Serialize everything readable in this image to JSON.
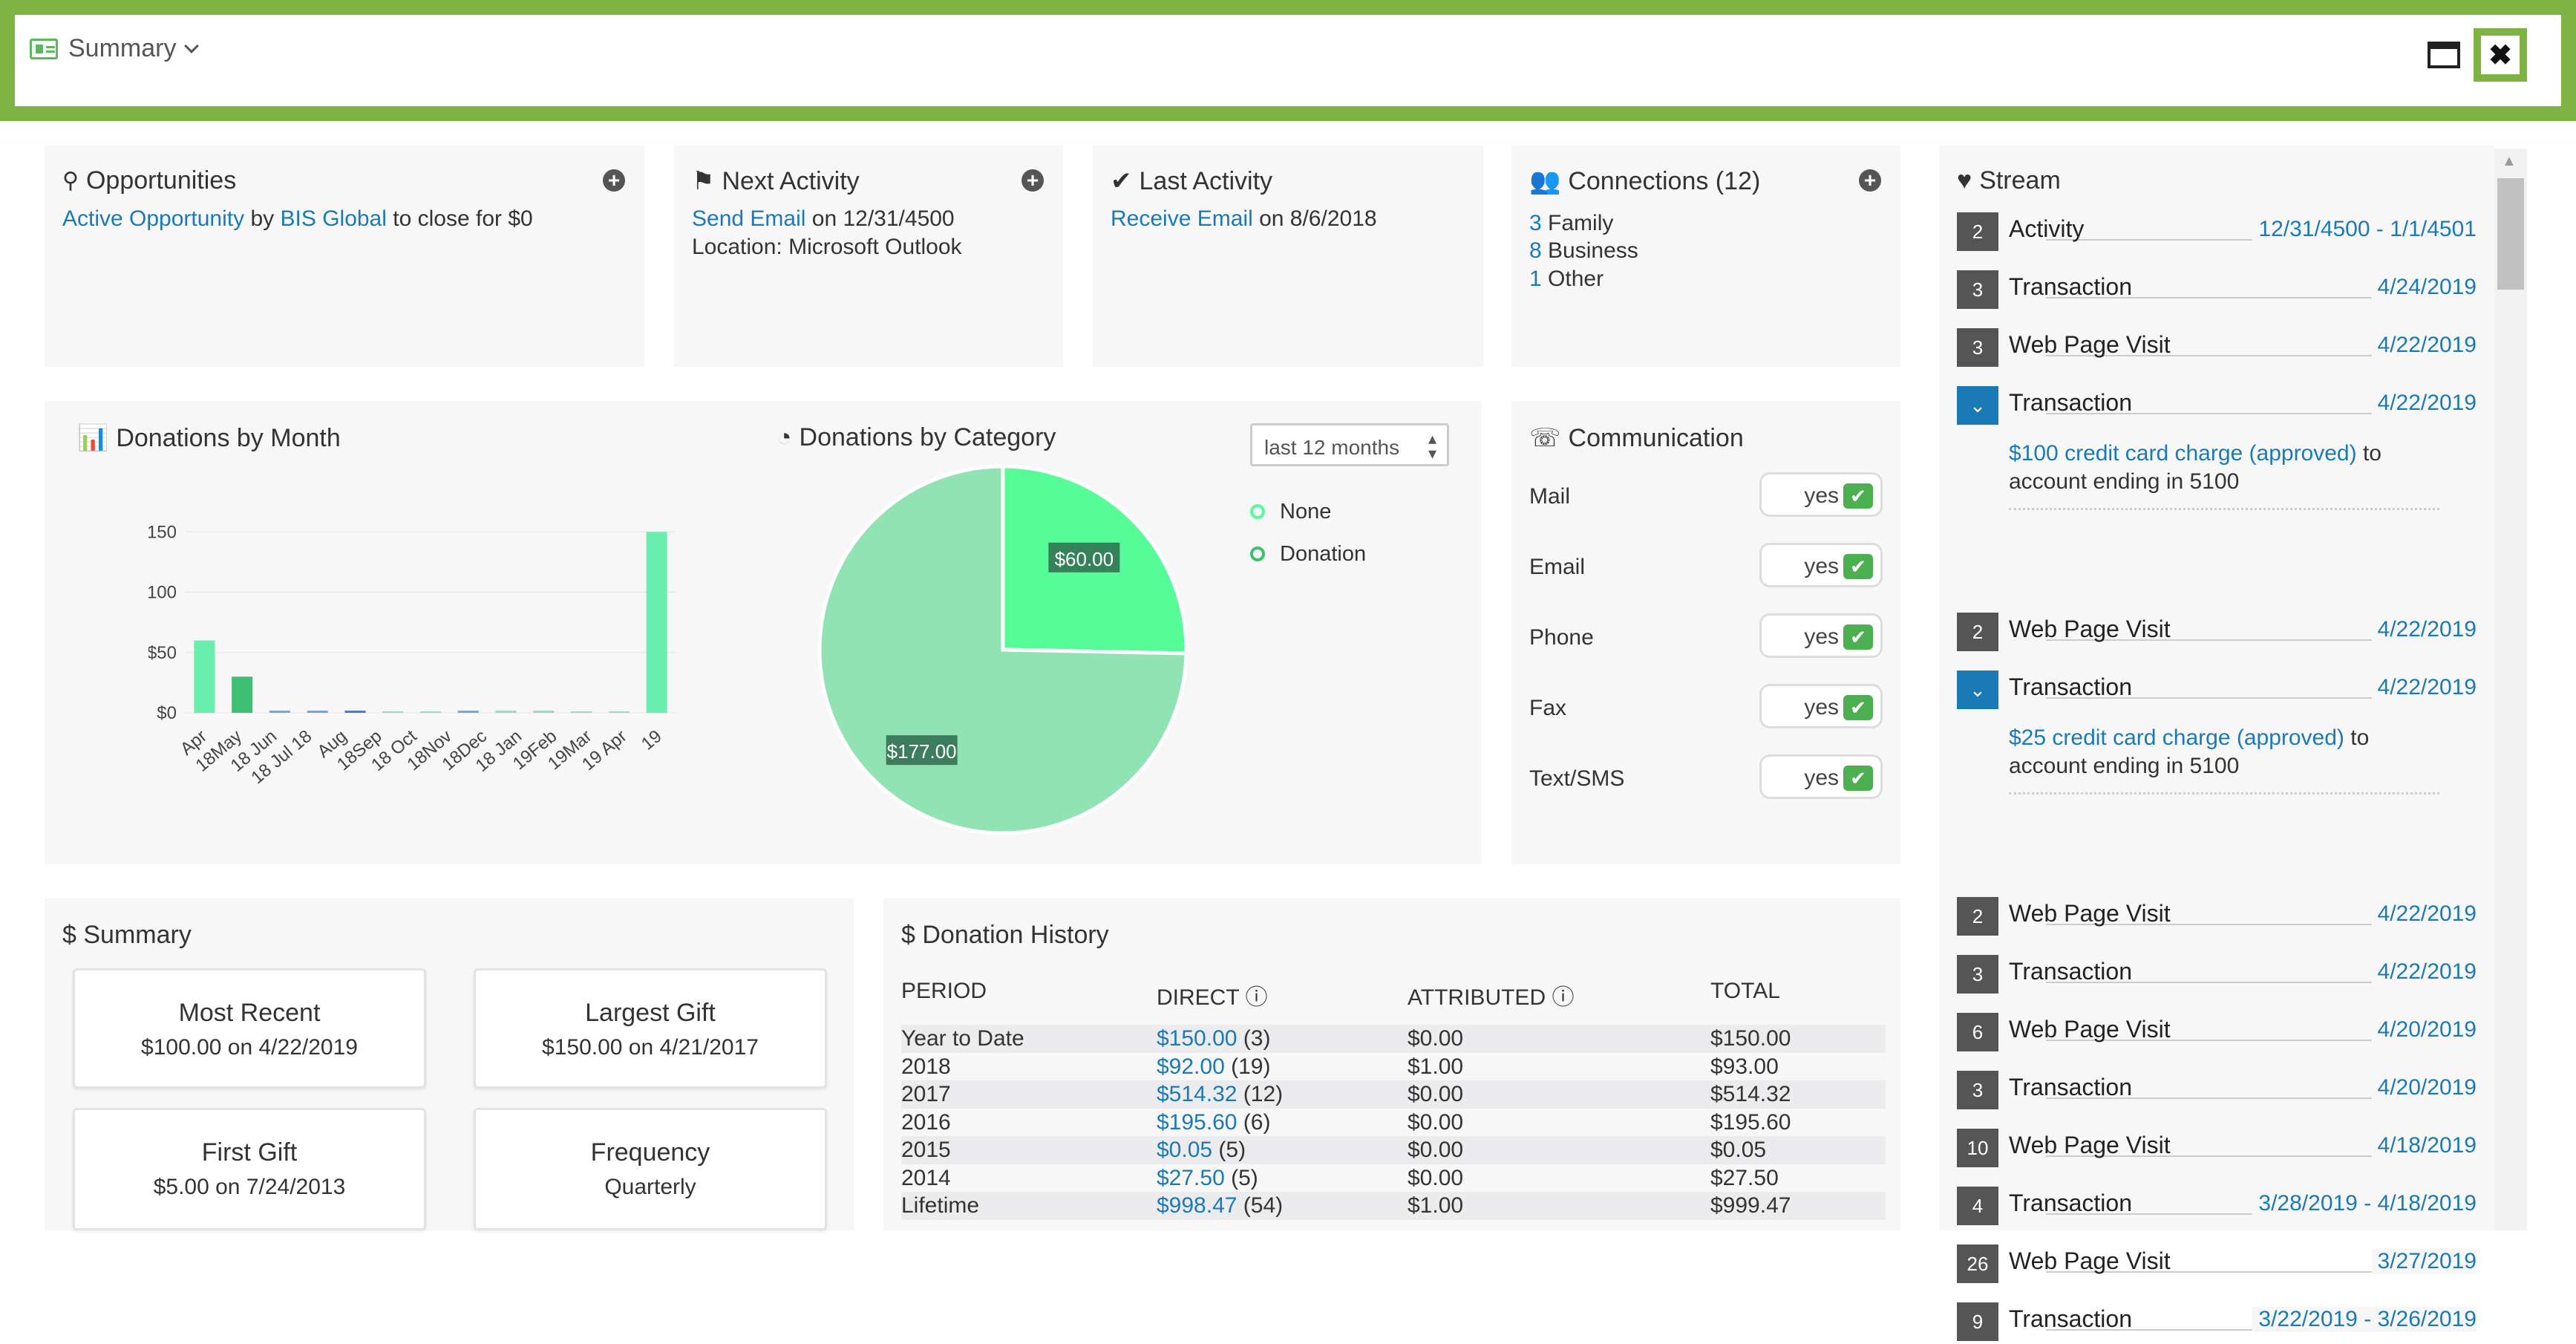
{
  "header": {
    "title": "Summary"
  },
  "opportunities": {
    "title": "Opportunities",
    "link1": "Active Opportunity",
    "by": "by",
    "link2": "BIS Global",
    "rest": "to close for $0"
  },
  "next_activity": {
    "title": "Next Activity",
    "link": "Send Email",
    "date": "on 12/31/4500",
    "location": "Location: Microsoft Outlook"
  },
  "last_activity": {
    "title": "Last Activity",
    "link": "Receive Email",
    "date": "on 8/6/2018"
  },
  "connections": {
    "title": "Connections (12)",
    "items": [
      {
        "n": "3",
        "label": "Family"
      },
      {
        "n": "8",
        "label": "Business"
      },
      {
        "n": "1",
        "label": "Other"
      }
    ]
  },
  "donations_month": {
    "title": "Donations by Month"
  },
  "donations_category": {
    "title": "Donations by Category",
    "period": "last 12 months"
  },
  "communication": {
    "title": "Communication",
    "rows": [
      {
        "label": "Mail",
        "value": "yes"
      },
      {
        "label": "Email",
        "value": "yes"
      },
      {
        "label": "Phone",
        "value": "yes"
      },
      {
        "label": "Fax",
        "value": "yes"
      },
      {
        "label": "Text/SMS",
        "value": "yes"
      }
    ]
  },
  "summary": {
    "title": "$ Summary",
    "cards": [
      {
        "title": "Most Recent",
        "value": "$100.00 on 4/22/2019"
      },
      {
        "title": "Largest Gift",
        "value": "$150.00 on 4/21/2017"
      },
      {
        "title": "First Gift",
        "value": "$5.00 on 7/24/2013"
      },
      {
        "title": "Frequency",
        "value": "Quarterly"
      }
    ]
  },
  "donation_history": {
    "title": "$ Donation History",
    "headers": [
      "PERIOD",
      "DIRECT",
      "ATTRIBUTED",
      "TOTAL"
    ],
    "rows": [
      {
        "period": "Year to Date",
        "direct": "$150.00",
        "count": "(3)",
        "attributed": "$0.00",
        "total": "$150.00"
      },
      {
        "period": "2018",
        "direct": "$92.00",
        "count": "(19)",
        "attributed": "$1.00",
        "total": "$93.00"
      },
      {
        "period": "2017",
        "direct": "$514.32",
        "count": "(12)",
        "attributed": "$0.00",
        "total": "$514.32"
      },
      {
        "period": "2016",
        "direct": "$195.60",
        "count": "(6)",
        "attributed": "$0.00",
        "total": "$195.60"
      },
      {
        "period": "2015",
        "direct": "$0.05",
        "count": "(5)",
        "attributed": "$0.00",
        "total": "$0.05"
      },
      {
        "period": "2014",
        "direct": "$27.50",
        "count": "(5)",
        "attributed": "$0.00",
        "total": "$27.50"
      },
      {
        "period": "Lifetime",
        "direct": "$998.47",
        "count": "(54)",
        "attributed": "$1.00",
        "total": "$999.47"
      }
    ]
  },
  "stream": {
    "title": "Stream",
    "rows": [
      {
        "badge": "2",
        "name": "Activity",
        "date": "12/31/4500 - 1/1/4501"
      },
      {
        "badge": "3",
        "name": "Transaction",
        "date": "4/24/2019"
      },
      {
        "badge": "3",
        "name": "Web Page Visit",
        "date": "4/22/2019"
      },
      {
        "badge": "⌄",
        "name": "Transaction",
        "date": "4/22/2019",
        "expanded": true
      },
      {
        "badge": "2",
        "name": "Web Page Visit",
        "date": "4/22/2019"
      },
      {
        "badge": "⌄",
        "name": "Transaction",
        "date": "4/22/2019",
        "expanded": true
      },
      {
        "badge": "2",
        "name": "Web Page Visit",
        "date": "4/22/2019"
      },
      {
        "badge": "3",
        "name": "Transaction",
        "date": "4/22/2019"
      },
      {
        "badge": "6",
        "name": "Web Page Visit",
        "date": "4/20/2019"
      },
      {
        "badge": "3",
        "name": "Transaction",
        "date": "4/20/2019"
      },
      {
        "badge": "10",
        "name": "Web Page Visit",
        "date": "4/18/2019"
      },
      {
        "badge": "4",
        "name": "Transaction",
        "date": "3/28/2019 - 4/18/2019"
      },
      {
        "badge": "26",
        "name": "Web Page Visit",
        "date": "3/27/2019"
      },
      {
        "badge": "9",
        "name": "Transaction",
        "date": "3/22/2019 - 3/26/2019"
      }
    ],
    "details": [
      {
        "link": "$100 credit card charge (approved)",
        "rest": "to",
        "line2": "account ending in 5100"
      },
      {
        "link": "$25 credit card charge (approved)",
        "rest": "to",
        "line2": "account ending in 5100"
      }
    ]
  },
  "chart_data": [
    {
      "type": "bar",
      "title": "Donations by Month",
      "categories": [
        "Apr 18",
        "May 18",
        "Jun 18",
        "Jul 18",
        "Aug 18",
        "Sep 18",
        "Oct 18",
        "Nov 18",
        "Dec 18",
        "Jan 19",
        "Feb 19",
        "Mar 19",
        "Apr 19"
      ],
      "tick_labels": [
        "Apr",
        "18May",
        "18 Jun",
        "18 Jul 18",
        "Aug",
        "18Sep",
        "18 Oct",
        "18Nov",
        "18Dec",
        "18 Jan",
        "19Feb",
        "19Mar",
        "19 Apr",
        "19"
      ],
      "values": [
        60,
        30,
        1,
        1,
        1,
        0,
        0,
        1,
        1,
        1,
        0,
        0,
        150
      ],
      "colors": [
        "#69f0ae",
        "#3dbf74",
        "#7aa6e0",
        "#7aa6e0",
        "#3f7fd6",
        "#9fd9c0",
        "#9fd9c0",
        "#7aa6e0",
        "#9fd9c0",
        "#9fd9c0",
        "#9fd9c0",
        "#9fd9c0",
        "#69f0ae"
      ],
      "yticks": [
        "$0",
        "$50",
        "$100",
        "$150"
      ],
      "ylim": [
        0,
        160
      ]
    },
    {
      "type": "pie",
      "title": "Donations by Category",
      "slices": [
        {
          "name": "None",
          "value": 60,
          "label": "$60.00",
          "color": "#56fc98"
        },
        {
          "name": "Donation",
          "value": 177,
          "label": "$177.00",
          "color": "#92e3b4"
        }
      ]
    }
  ]
}
